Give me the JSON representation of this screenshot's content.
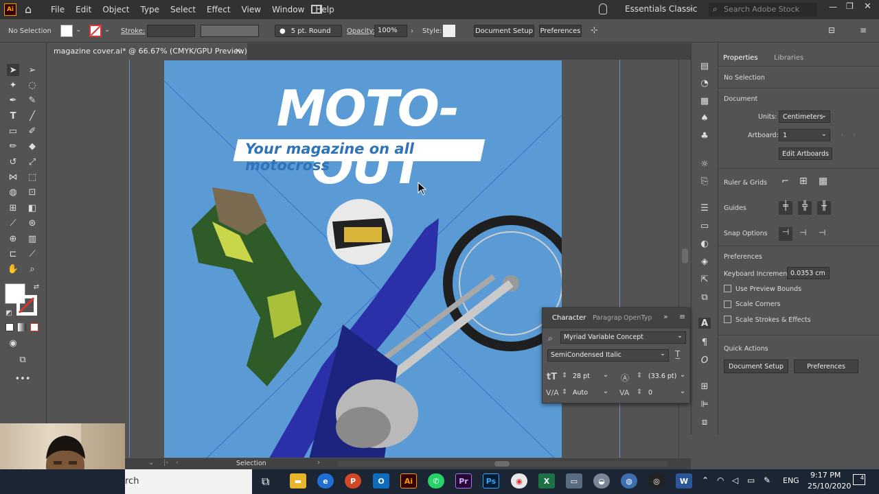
{
  "menubar": {
    "app_icon": "Ai",
    "items": [
      "File",
      "Edit",
      "Object",
      "Type",
      "Select",
      "Effect",
      "View",
      "Window",
      "Help"
    ],
    "workspace": "Essentials Classic",
    "search_placeholder": "Search Adobe Stock"
  },
  "controlbar": {
    "selection": "No Selection",
    "stroke_label": "Stroke:",
    "brush": "5 pt. Round",
    "opacity_label": "Opacity:",
    "opacity_value": "100%",
    "style_label": "Style:",
    "document_setup": "Document Setup",
    "preferences": "Preferences"
  },
  "tab": {
    "title": "magazine cover.ai* @ 66.67% (CMYK/GPU Preview)",
    "close": "×"
  },
  "artboard": {
    "title": "MOTO-OUT",
    "subtitle": "Your magazine on all motocross",
    "background_color": "#5a9bd6"
  },
  "properties": {
    "tabs": [
      "Properties",
      "Libraries"
    ],
    "selection": "No Selection",
    "document_heading": "Document",
    "units_label": "Units:",
    "units_value": "Centimeters",
    "artboard_label": "Artboard:",
    "artboard_value": "1",
    "edit_artboards": "Edit Artboards",
    "ruler_grids": "Ruler & Grids",
    "guides": "Guides",
    "snap_options": "Snap Options",
    "preferences_heading": "Preferences",
    "keyboard_increment_label": "Keyboard Increment:",
    "keyboard_increment_value": "0.0353 cm",
    "checkboxes": [
      "Use Preview Bounds",
      "Scale Corners",
      "Scale Strokes & Effects"
    ],
    "quick_actions": "Quick Actions",
    "qa_document_setup": "Document Setup",
    "qa_preferences": "Preferences"
  },
  "character": {
    "tabs": [
      "Character",
      "Paragrap",
      "OpenTyp"
    ],
    "font_family": "Myriad Variable Concept",
    "font_style": "SemiCondensed Italic",
    "size": "28 pt",
    "leading": "(33.6 pt)",
    "kerning": "Auto",
    "tracking": "0"
  },
  "statusbar": {
    "tool": "Selection"
  },
  "taskbar": {
    "search_text": "rch",
    "language": "ENG",
    "time": "9:17 PM",
    "date": "25/10/2020",
    "notifications": "4"
  }
}
